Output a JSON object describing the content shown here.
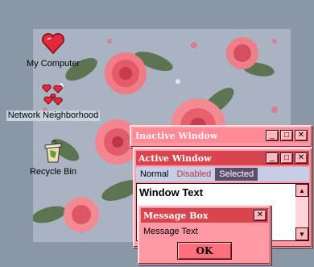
{
  "desktop": {
    "icons": [
      {
        "label": "My Computer",
        "icon": "heart-icon"
      },
      {
        "label": "Network Neighborhood",
        "icon": "hearts-network-icon",
        "selected": true
      },
      {
        "label": "Recycle Bin",
        "icon": "recycle-bin-icon"
      }
    ],
    "background_color": "#8a97a6"
  },
  "inactive_window": {
    "title": "Inactive Window",
    "buttons": {
      "minimize": "_",
      "maximize": "□",
      "close": "✕"
    }
  },
  "active_window": {
    "title": "Active Window",
    "buttons": {
      "minimize": "_",
      "maximize": "□",
      "close": "✕"
    },
    "menu": {
      "normal": "Normal",
      "disabled": "Disabled",
      "selected": "Selected"
    },
    "window_text": "Window Text",
    "scroll_up": "▲",
    "scroll_down": "▼"
  },
  "message_box": {
    "title": "Message Box",
    "close": "✕",
    "text": "Message Text",
    "ok_label": "OK"
  },
  "colors": {
    "window_face": "#ff9aa4",
    "active_title": "#d8454f",
    "inactive_title": "#ff8a96",
    "menu_bar": "#c6cde6",
    "selected_menu": "#5b4d6b",
    "disabled_text": "#c33346"
  }
}
